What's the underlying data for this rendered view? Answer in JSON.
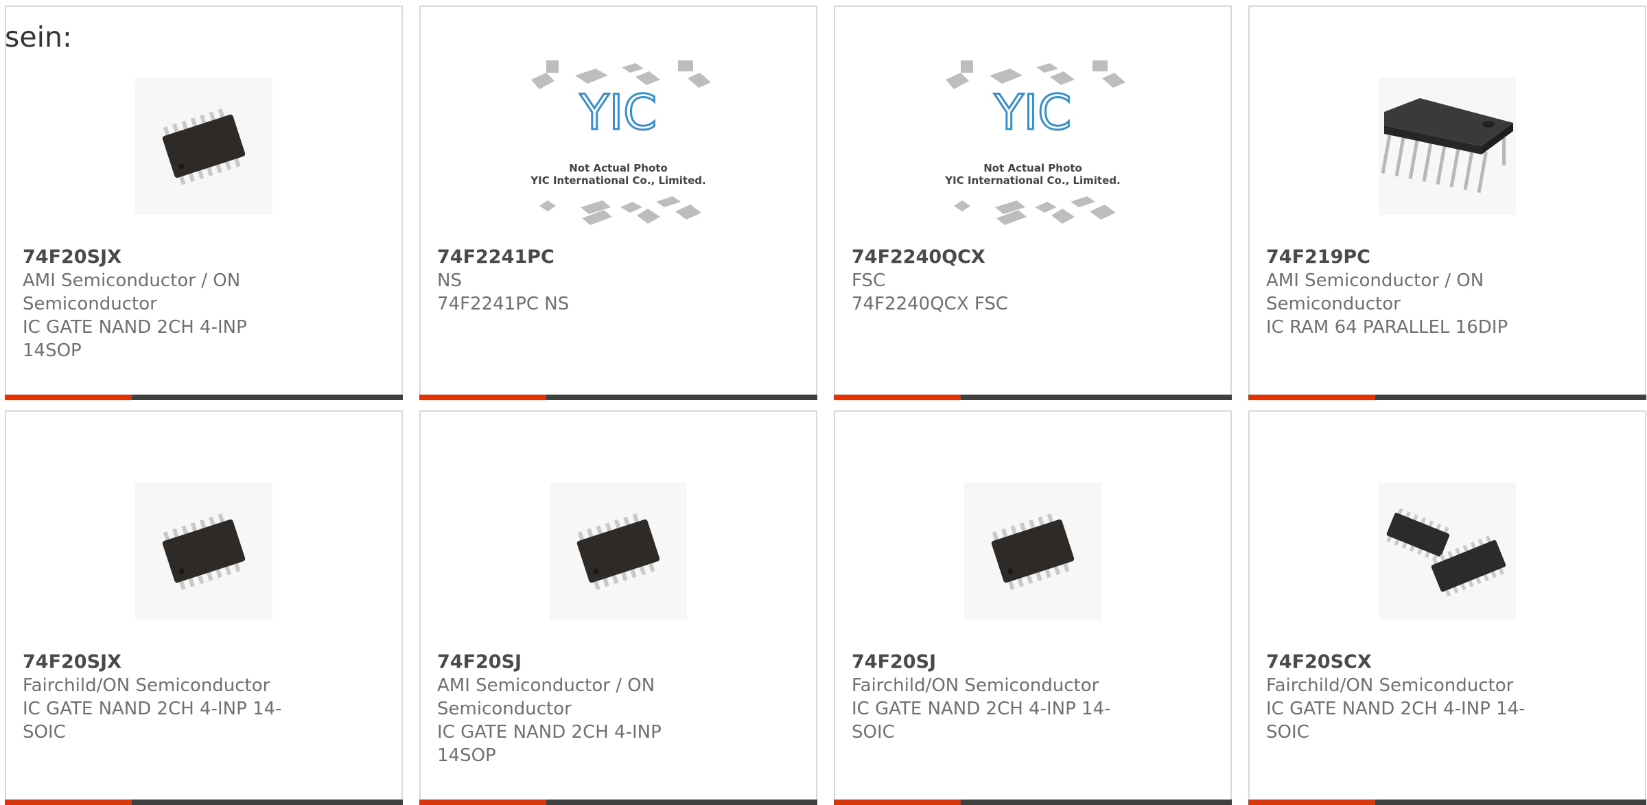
{
  "heading": "sein:",
  "products": [
    {
      "part": "74F20SJX",
      "manufacturer": "AMI Semiconductor / ON Semiconductor",
      "description": "IC GATE NAND 2CH 4-INP 14SOP",
      "image": "soic-chip"
    },
    {
      "part": "74F2241PC",
      "manufacturer": "NS",
      "description": "74F2241PC NS",
      "image": "placeholder",
      "placeholder_text": [
        "Not Actual Photo",
        "YIC International Co., Limited."
      ],
      "placeholder_logo": "YIC"
    },
    {
      "part": "74F2240QCX",
      "manufacturer": "FSC",
      "description": "74F2240QCX FSC",
      "image": "placeholder",
      "placeholder_text": [
        "Not Actual Photo",
        "YIC International Co., Limited."
      ],
      "placeholder_logo": "YIC"
    },
    {
      "part": "74F219PC",
      "manufacturer": "AMI Semiconductor / ON Semiconductor",
      "description": "IC RAM 64 PARALLEL 16DIP",
      "image": "dip-chip"
    },
    {
      "part": "74F20SJX",
      "manufacturer": "Fairchild/ON Semiconductor",
      "description": "IC GATE NAND 2CH 4-INP 14-SOIC",
      "image": "soic-chip"
    },
    {
      "part": "74F20SJ",
      "manufacturer": "AMI Semiconductor / ON Semiconductor",
      "description": "IC GATE NAND 2CH 4-INP 14SOP",
      "image": "soic-chip"
    },
    {
      "part": "74F20SJ",
      "manufacturer": "Fairchild/ON Semiconductor",
      "description": "IC GATE NAND 2CH 4-INP 14-SOIC",
      "image": "soic-chip"
    },
    {
      "part": "74F20SCX",
      "manufacturer": "Fairchild/ON Semiconductor",
      "description": "IC GATE NAND 2CH 4-INP 14-SOIC",
      "image": "dual-soic-chip"
    }
  ],
  "colors": {
    "accent": "#d9360b",
    "bar": "#3f3f3f",
    "border": "#d9d9d9",
    "placeholder_blue": "#3a8fc8"
  }
}
